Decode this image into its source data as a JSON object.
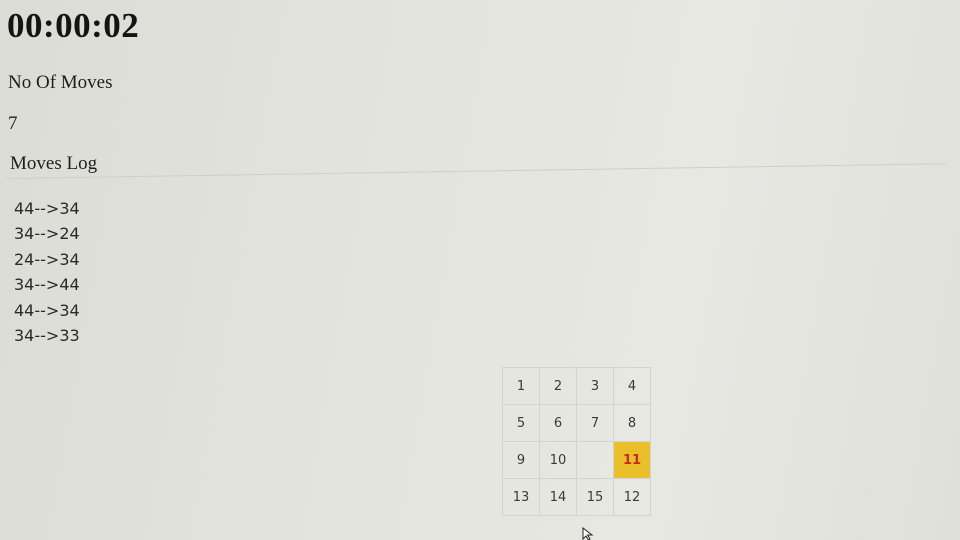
{
  "timer": "00:00:02",
  "moves": {
    "label": "No Of Moves",
    "count": "7"
  },
  "log": {
    "title": "Moves Log",
    "entries": [
      "44-->34",
      "34-->24",
      "24-->34",
      "34-->44",
      "44-->34",
      "34-->33"
    ]
  },
  "board": {
    "tiles": [
      "1",
      "2",
      "3",
      "4",
      "5",
      "6",
      "7",
      "8",
      "9",
      "10",
      "",
      "11",
      "13",
      "14",
      "15",
      "12"
    ],
    "highlighted_tile": "11",
    "highlight_color": "#e9c02a",
    "highlight_text_color": "#c8291a"
  }
}
